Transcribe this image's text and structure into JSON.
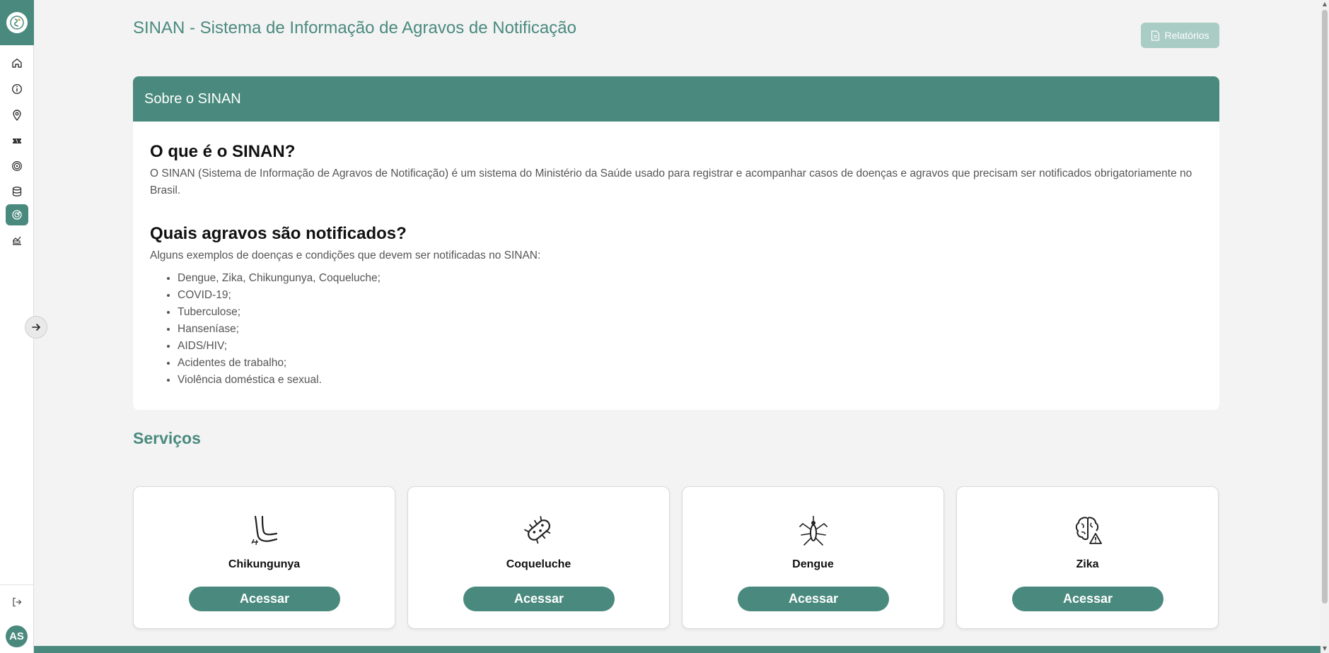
{
  "sidebar": {
    "avatar_initials": "AS",
    "items": [
      {
        "icon": "home-icon"
      },
      {
        "icon": "info-icon"
      },
      {
        "icon": "map-pin-icon"
      },
      {
        "icon": "ticket-icon"
      },
      {
        "icon": "target-icon"
      },
      {
        "icon": "database-icon"
      },
      {
        "icon": "radar-icon",
        "active": true
      },
      {
        "icon": "reports-icon"
      }
    ]
  },
  "header": {
    "title": "SINAN - Sistema de Informação de Agravos de Notificação",
    "reports_button": "Relatórios"
  },
  "about": {
    "header": "Sobre o SINAN",
    "q1": "O que é o SINAN?",
    "p1": "O SINAN (Sistema de Informação de Agravos de Notificação) é um sistema do Ministério da Saúde usado para registrar e acompanhar casos de doenças e agravos que precisam ser notificados obrigatoriamente no Brasil.",
    "q2": "Quais agravos são notificados?",
    "p2": "Alguns exemplos de doenças e condições que devem ser notificadas no SINAN:",
    "list": [
      "Dengue, Zika, Chikungunya, Coqueluche;",
      "COVID-19;",
      "Tuberculose;",
      "Hanseníase;",
      "AIDS/HIV;",
      "Acidentes de trabalho;",
      "Violência doméstica e sexual."
    ]
  },
  "services": {
    "title": "Serviços",
    "cards": [
      {
        "name": "Chikungunya",
        "button": "Acessar",
        "icon": "joint-pain-icon"
      },
      {
        "name": "Coqueluche",
        "button": "Acessar",
        "icon": "bacteria-icon"
      },
      {
        "name": "Dengue",
        "button": "Acessar",
        "icon": "mosquito-icon"
      },
      {
        "name": "Zika",
        "button": "Acessar",
        "icon": "brain-warning-icon"
      }
    ]
  },
  "colors": {
    "brand": "#4a8a7e",
    "brand_light": "#a9ccc4",
    "background": "#f3f3f3"
  }
}
